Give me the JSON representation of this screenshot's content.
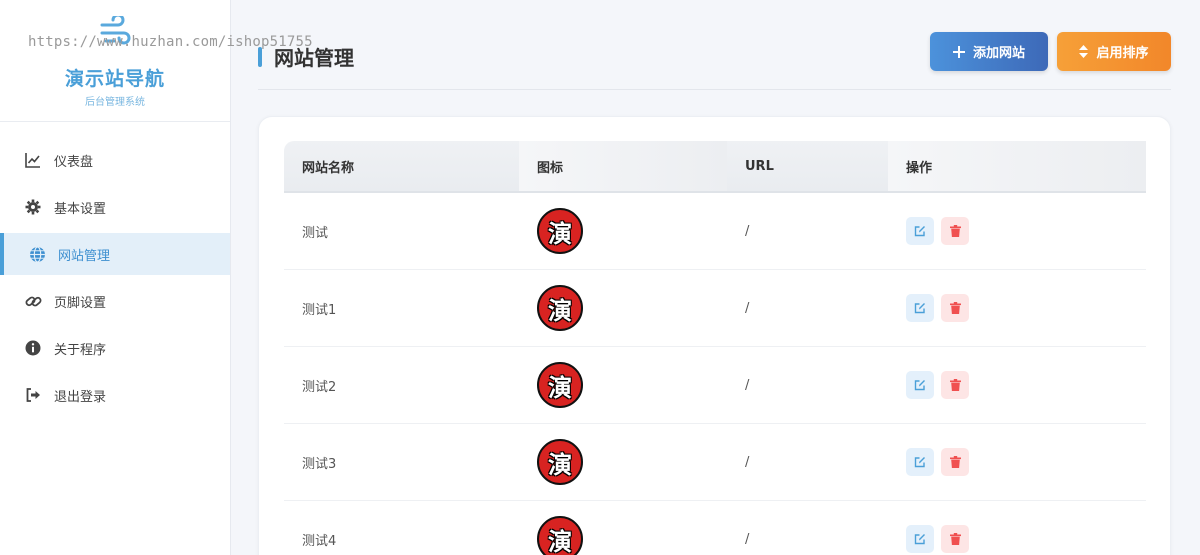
{
  "watermark": "https://www.huzhan.com/ishop51755",
  "brand": {
    "title": "演示站导航",
    "subtitle": "后台管理系统"
  },
  "nav": [
    {
      "label": "仪表盘",
      "icon": "chart-line-icon",
      "active": false
    },
    {
      "label": "基本设置",
      "icon": "gear-icon",
      "active": false
    },
    {
      "label": "网站管理",
      "icon": "globe-icon",
      "active": true
    },
    {
      "label": "页脚设置",
      "icon": "link-icon",
      "active": false
    },
    {
      "label": "关于程序",
      "icon": "info-icon",
      "active": false
    },
    {
      "label": "退出登录",
      "icon": "logout-icon",
      "active": false
    }
  ],
  "header": {
    "title": "网站管理",
    "add_label": "添加网站",
    "sort_label": "启用排序"
  },
  "table": {
    "columns": [
      "网站名称",
      "图标",
      "URL",
      "操作"
    ],
    "icon_glyph": "演",
    "rows": [
      {
        "name": "测试",
        "url": "/"
      },
      {
        "name": "测试1",
        "url": "/"
      },
      {
        "name": "测试2",
        "url": "/"
      },
      {
        "name": "测试3",
        "url": "/"
      },
      {
        "name": "测试4",
        "url": "/"
      }
    ]
  },
  "colors": {
    "accent": "#4a9fd8",
    "add_button": "#3d69b8",
    "sort_button": "#f2872a",
    "edit": "#4a9fd8",
    "delete": "#f05050"
  }
}
